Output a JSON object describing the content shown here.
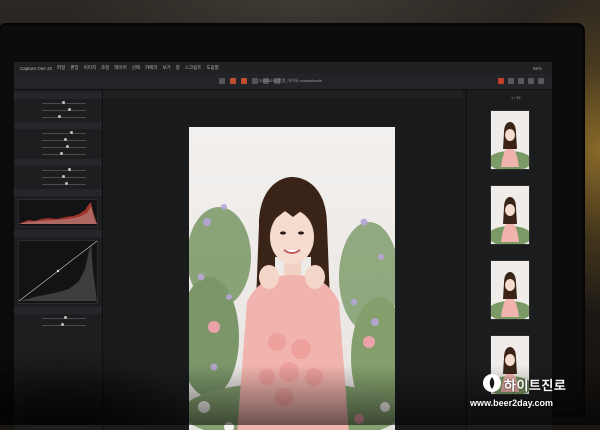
{
  "app": {
    "name": "Capture One 22",
    "menus": [
      "파일",
      "편집",
      "이미지",
      "조정",
      "레이어",
      "선택",
      "카메라",
      "보기",
      "창",
      "스크립트",
      "도움말"
    ],
    "status": "96%"
  },
  "document": {
    "title": "20201010 촬영_아이유.cosessiondb"
  },
  "browser": {
    "count": "1 / 51"
  },
  "watermark": {
    "brand": "하이트진로",
    "url": "www.beer2day.com"
  },
  "colors": {
    "accent_tool": "#c0502e",
    "watermark": "#ffffff"
  }
}
